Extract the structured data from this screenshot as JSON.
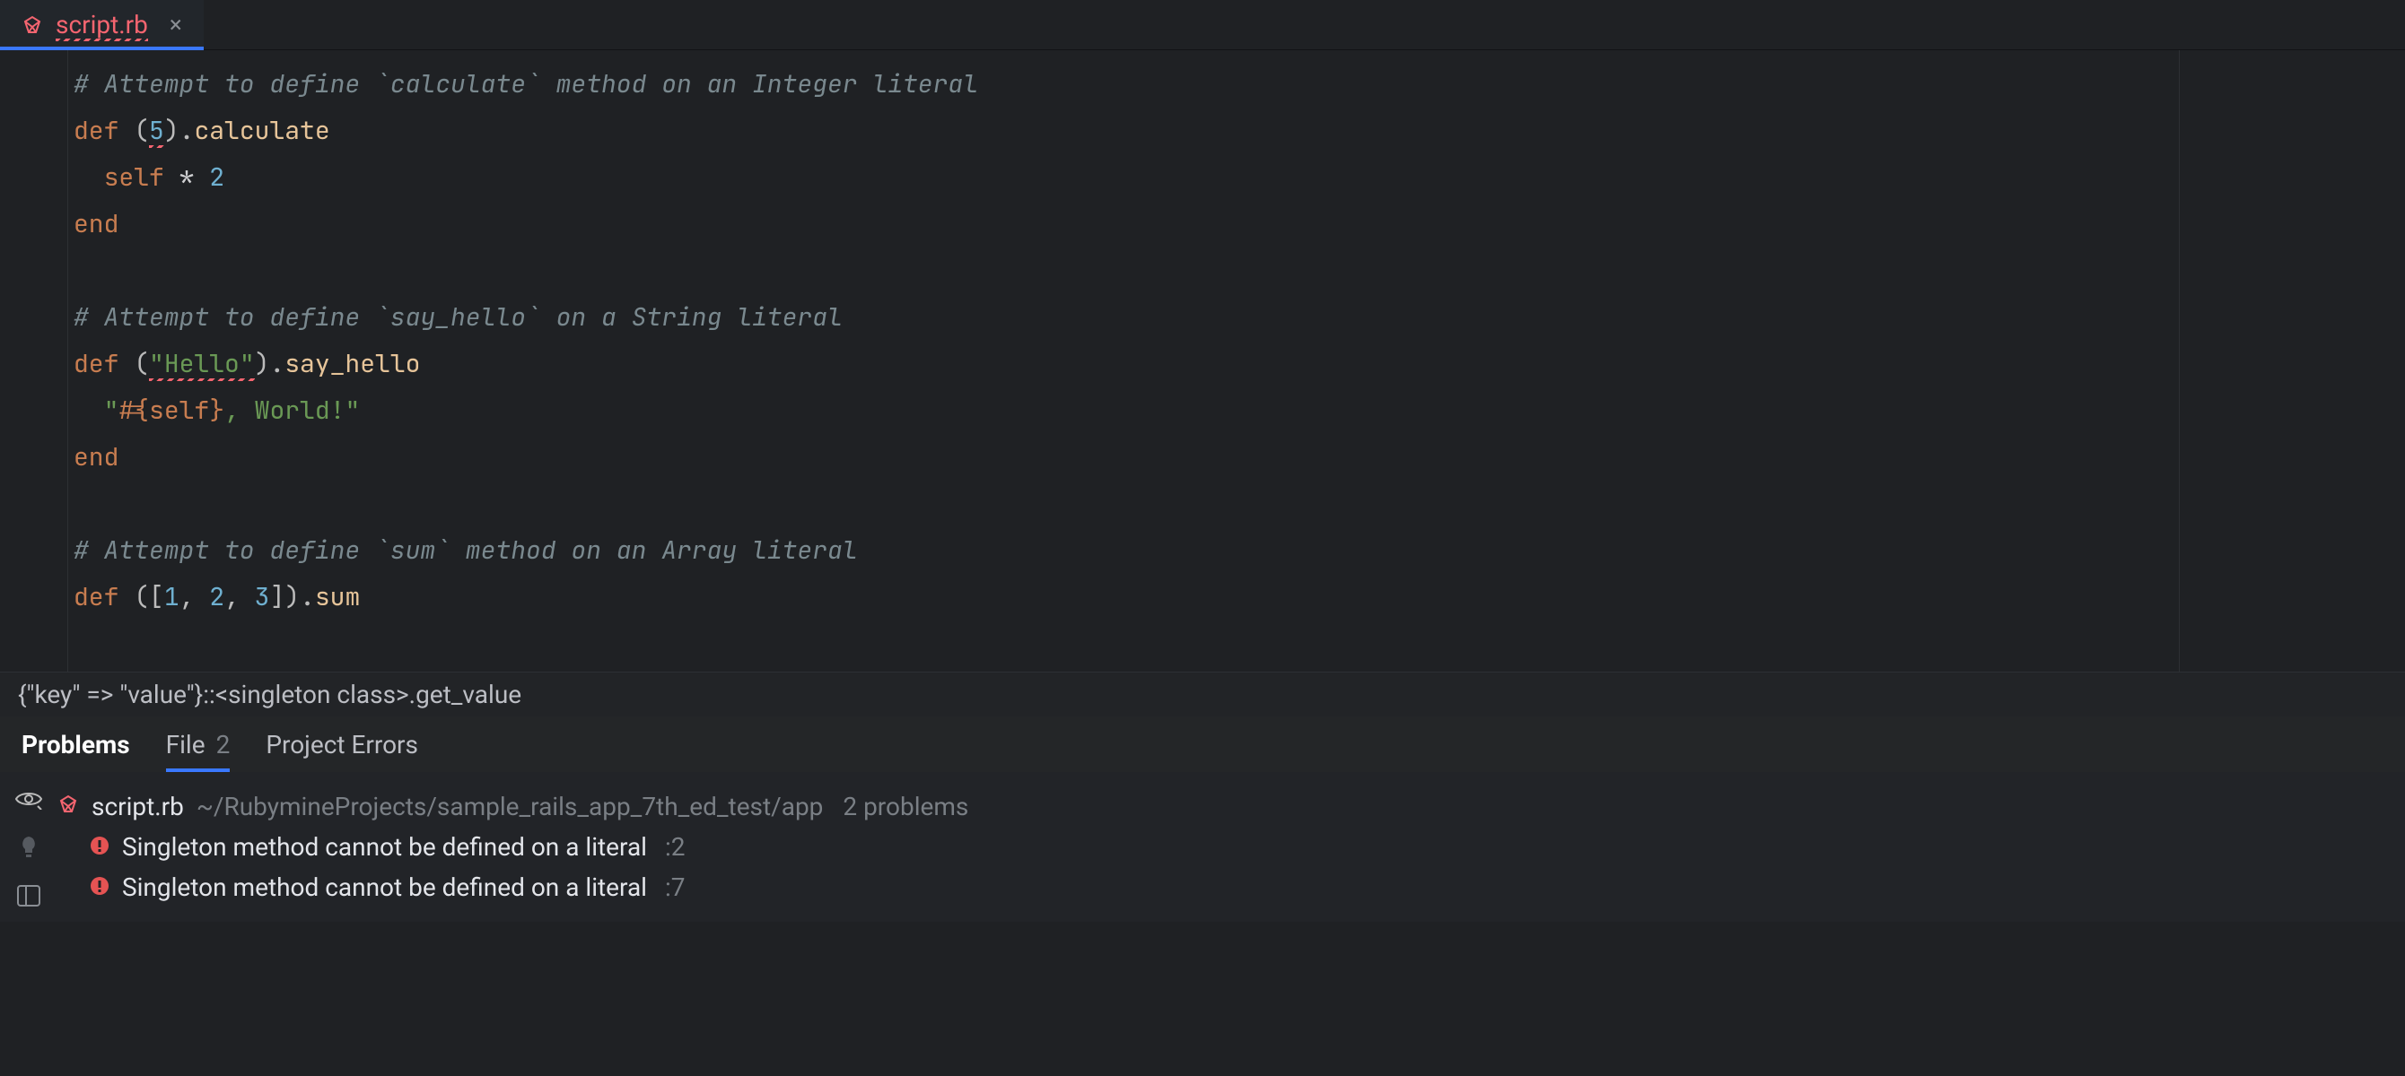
{
  "tab": {
    "filename": "script.rb",
    "close_glyph": "×"
  },
  "code": {
    "l1": "# Attempt to define `calculate` method on an Integer literal",
    "l2": {
      "kw_def": "def",
      "open": " (",
      "num": "5",
      "close_dot": ").",
      "meth": "calculate"
    },
    "l3": {
      "indent": "  ",
      "self_kw": "self",
      "op": " * ",
      "num": "2"
    },
    "l4": {
      "kw_end": "end"
    },
    "l6": "# Attempt to define `say_hello` on a String literal",
    "l7": {
      "kw_def": "def",
      "open": " (",
      "str": "\"Hello\"",
      "close_dot": ").",
      "meth": "say_hello"
    },
    "l8": {
      "indent": "  ",
      "open_q": "\"",
      "interp_open": "#{",
      "self_kw": "self",
      "interp_close": "}",
      "rest": ", World!",
      "close_q": "\""
    },
    "l9": {
      "kw_end": "end"
    },
    "l11": "# Attempt to define `sum` method on an Array literal",
    "l12": {
      "kw_def": "def",
      "open": " ([",
      "a": "1",
      "c1": ", ",
      "b": "2",
      "c2": ", ",
      "c": "3",
      "close_dot": "]).",
      "meth": "sum"
    }
  },
  "breadcrumb": {
    "text_left": "{\"key\" => \"value\"}::",
    "lt": "<",
    "mid": "singleton class",
    "gt": ">.",
    "tail": "get_value"
  },
  "panel": {
    "tab_strong": "Problems",
    "tab_file": "File",
    "tab_file_count": "2",
    "tab_project": "Project Errors"
  },
  "problems": {
    "file": "script.rb",
    "path": "~/RubymineProjects/sample_rails_app_7th_ed_test/app",
    "count": "2 problems",
    "errors": [
      {
        "msg": "Singleton method cannot be defined on a literal",
        "line": ":2"
      },
      {
        "msg": "Singleton method cannot be defined on a literal",
        "line": ":7"
      }
    ]
  }
}
